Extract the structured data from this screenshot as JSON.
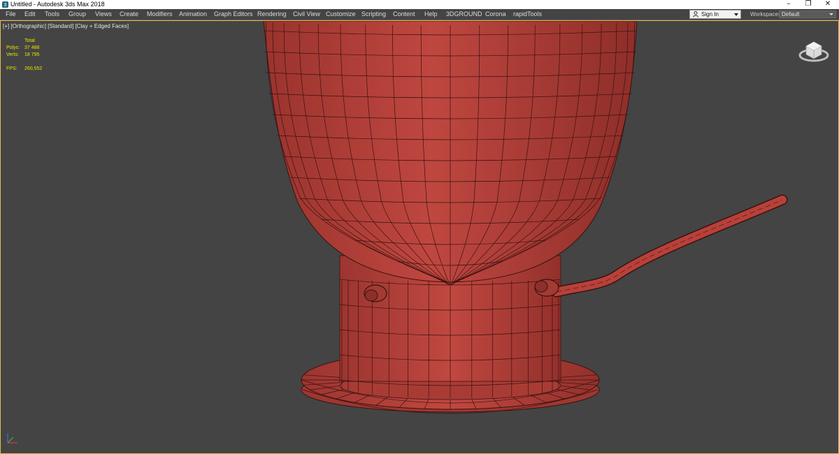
{
  "window": {
    "title": "Untitled - Autodesk 3ds Max 2018",
    "controls": {
      "minimize": "–",
      "maximize": "❐",
      "close": "✕"
    }
  },
  "menubar": {
    "items": [
      {
        "label": "File"
      },
      {
        "label": "Edit"
      },
      {
        "label": "Tools"
      },
      {
        "label": "Group"
      },
      {
        "label": "Views"
      },
      {
        "label": "Create"
      },
      {
        "label": "Modifiers"
      },
      {
        "label": "Animation"
      },
      {
        "label": "Graph Editors"
      },
      {
        "label": "Rendering"
      },
      {
        "label": "Civil View"
      },
      {
        "label": "Customize"
      },
      {
        "label": "Scripting"
      },
      {
        "label": "Content"
      },
      {
        "label": "Help"
      },
      {
        "label": "3DGROUND"
      },
      {
        "label": "Corona"
      },
      {
        "label": "rapidTools"
      }
    ],
    "sign_in": "Sign In",
    "workspaces_label": "Workspaces:",
    "workspaces_value": "Default"
  },
  "viewport": {
    "label": "[+] [Orthographic] [Standard] [Clay + Edged Faces]",
    "stats": {
      "header": "Total",
      "polys_label": "Polys:",
      "polys_value": "37 488",
      "verts_label": "Verts:",
      "verts_value": "18 795",
      "fps_label": "FPS:",
      "fps_value": "260,552"
    },
    "accent_color": "#e3c046",
    "model_color": "#b8413a",
    "wire_color": "#3a1210"
  }
}
